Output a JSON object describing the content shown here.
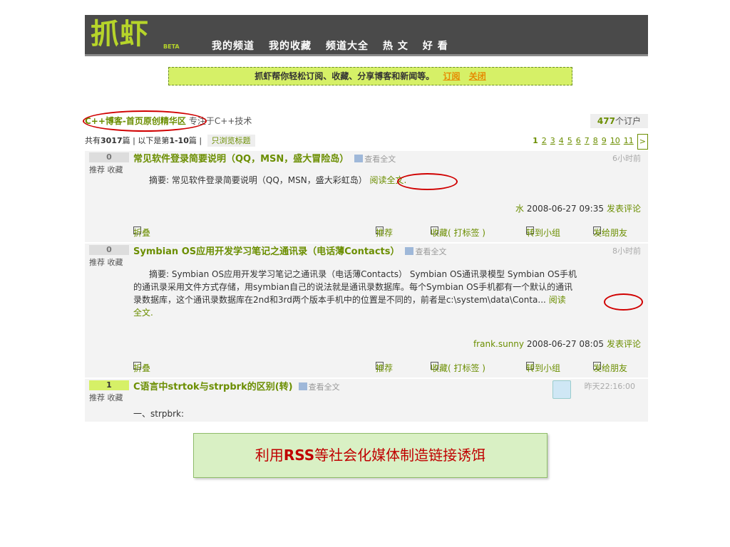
{
  "header": {
    "logo": "抓虾",
    "logo_badge": "BETA",
    "nav": [
      "我的频道",
      "我的收藏",
      "频道大全",
      "热 文",
      "好 看"
    ]
  },
  "notice": {
    "text": "抓虾帮你轻松订阅、收藏、分享博客和新闻等。",
    "subscribe": "订阅",
    "close": "关闭"
  },
  "group": {
    "name": "C++博客-首页原创精华区",
    "desc": "专注于C++技术",
    "subscribers_count": "477",
    "subscribers_label": "个订户"
  },
  "listing": {
    "total_prefix": "共有",
    "total": "3017",
    "total_suffix": "篇",
    "range_prefix": "| 以下是第",
    "range": "1-10",
    "range_suffix": "篇 |",
    "titles_only": "只浏览标题",
    "pages": [
      "1",
      "2",
      "3",
      "4",
      "5",
      "6",
      "7",
      "8",
      "9",
      "10",
      "11"
    ],
    "next": ">"
  },
  "labels": {
    "recommend_short": "推荐",
    "favorite_short": "收藏",
    "view_all": "查看全文",
    "collapse": "折叠",
    "recommend": "推荐",
    "favorite_tag": "收藏( 打标签 )",
    "to_group": "转到小组",
    "send_friend": "发给朋友",
    "comment": "发表评论",
    "summary_prefix": "摘要:"
  },
  "posts": [
    {
      "votes": "0",
      "title": "常见软件登录简要说明（QQ，MSN，盛大冒险岛）",
      "time": "6小时前",
      "summary": "常见软件登录简要说明（QQ，MSN，盛大彩虹岛）",
      "read_more": "阅读全文.",
      "author": "水",
      "date": "2008-06-27 09:35"
    },
    {
      "votes": "0",
      "title": "Symbian OS应用开发学习笔记之通讯录（电话薄Contacts）",
      "time": "8小时前",
      "summary_l1": "Symbian OS应用开发学习笔记之通讯录（电话薄Contacts）  Symbian OS通讯录模型 Symbian OS手机",
      "summary_l2": "的通讯录采用文件方式存储，用symbian自己的说法就是通讯录数据库。每个Symbian OS手机都有一个默认的通讯",
      "summary_l3": "录数据库，这个通讯录数据库在2nd和3rd两个版本手机中的位置是不同的，前者是c:\\system\\data\\Conta...",
      "read_more_1": "阅读",
      "read_more_2": "全文.",
      "author": "frank.sunny",
      "date": "2008-06-27 08:05"
    },
    {
      "votes": "1",
      "title": "C语言中strtok与strpbrk的区别(转)",
      "time": "昨天22:16:00",
      "summary": "一、strpbrk:"
    }
  ],
  "caption": {
    "before": "利用",
    "rss": "RSS",
    "after": "等社会化媒体制造链接诱饵"
  }
}
